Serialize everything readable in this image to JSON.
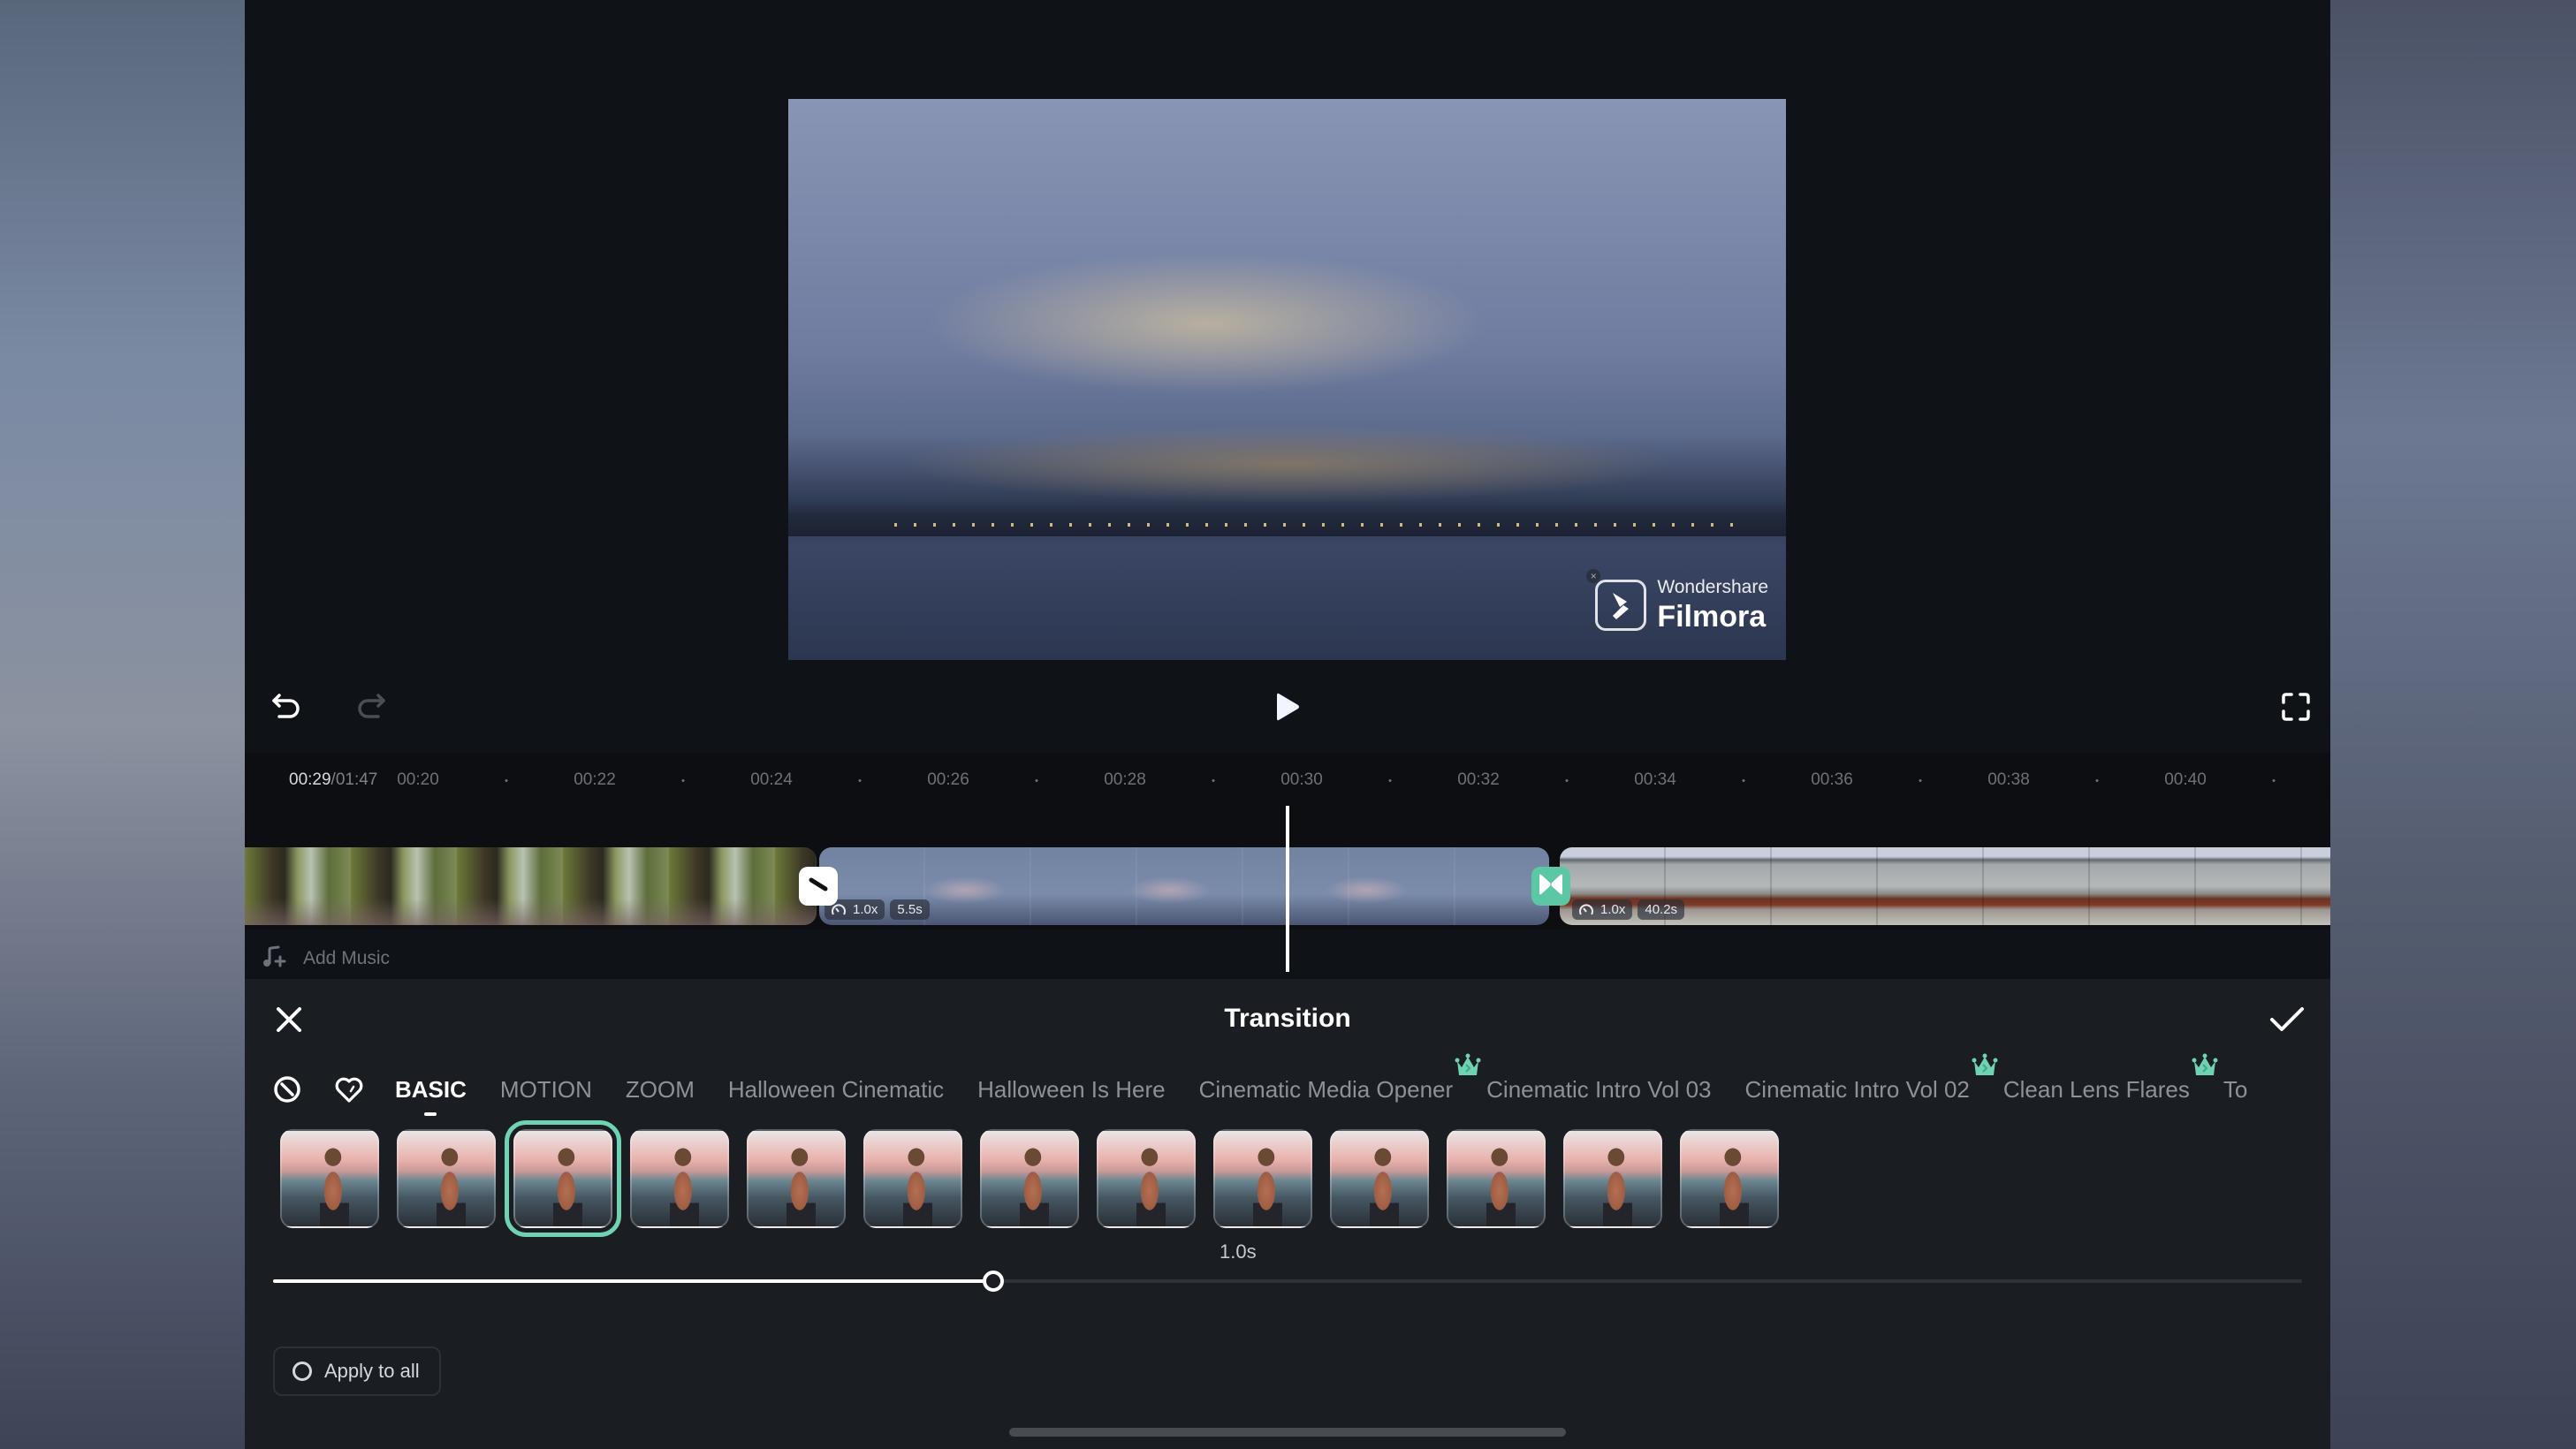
{
  "preview": {
    "watermark_brand": "Wondershare",
    "watermark_product": "Filmora"
  },
  "controls": {
    "undo": "undo-icon",
    "redo": "redo-icon",
    "play": "play-icon",
    "fullscreen": "fullscreen-icon"
  },
  "timeline": {
    "current_time": "00:29",
    "total_time": "/01:47",
    "ticks": [
      "00:20",
      "00:22",
      "00:24",
      "00:26",
      "00:28",
      "00:30",
      "00:32",
      "00:34",
      "00:36",
      "00:38",
      "00:40"
    ],
    "clips": [
      {
        "name": "forest-clip"
      },
      {
        "name": "sky-clip",
        "speed": "1.0x",
        "duration": "5.5s"
      },
      {
        "name": "sea-clip",
        "speed": "1.0x",
        "duration": "40.2s"
      }
    ],
    "transitions": [
      {
        "state": "none",
        "icon": "no-transition-icon"
      },
      {
        "state": "applied",
        "icon": "transition-bowtie-icon"
      }
    ],
    "add_music_label": "Add Music"
  },
  "panel": {
    "title": "Transition",
    "tabs": [
      {
        "label": "BASIC",
        "active": true,
        "premium": false
      },
      {
        "label": "MOTION",
        "active": false,
        "premium": false
      },
      {
        "label": "ZOOM",
        "active": false,
        "premium": false
      },
      {
        "label": "Halloween Cinematic",
        "active": false,
        "premium": false
      },
      {
        "label": "Halloween Is Here",
        "active": false,
        "premium": false
      },
      {
        "label": "Cinematic Media Opener",
        "active": false,
        "premium": true
      },
      {
        "label": "Cinematic Intro Vol 03",
        "active": false,
        "premium": false
      },
      {
        "label": "Cinematic Intro Vol 02",
        "active": false,
        "premium": true
      },
      {
        "label": "Clean Lens Flares",
        "active": false,
        "premium": true
      },
      {
        "label": "To",
        "active": false,
        "premium": false
      }
    ],
    "thumbnail_count": 13,
    "selected_thumbnail_index": 2,
    "duration_label": "1.0s",
    "duration_fraction": 0.355,
    "apply_to_all_label": "Apply to all",
    "apply_to_all_checked": false
  },
  "colors": {
    "accent": "#6fd3b3",
    "transition_active": "#5cc7a4",
    "panel_bg": "#1a1d21",
    "app_bg": "#0f1317"
  }
}
